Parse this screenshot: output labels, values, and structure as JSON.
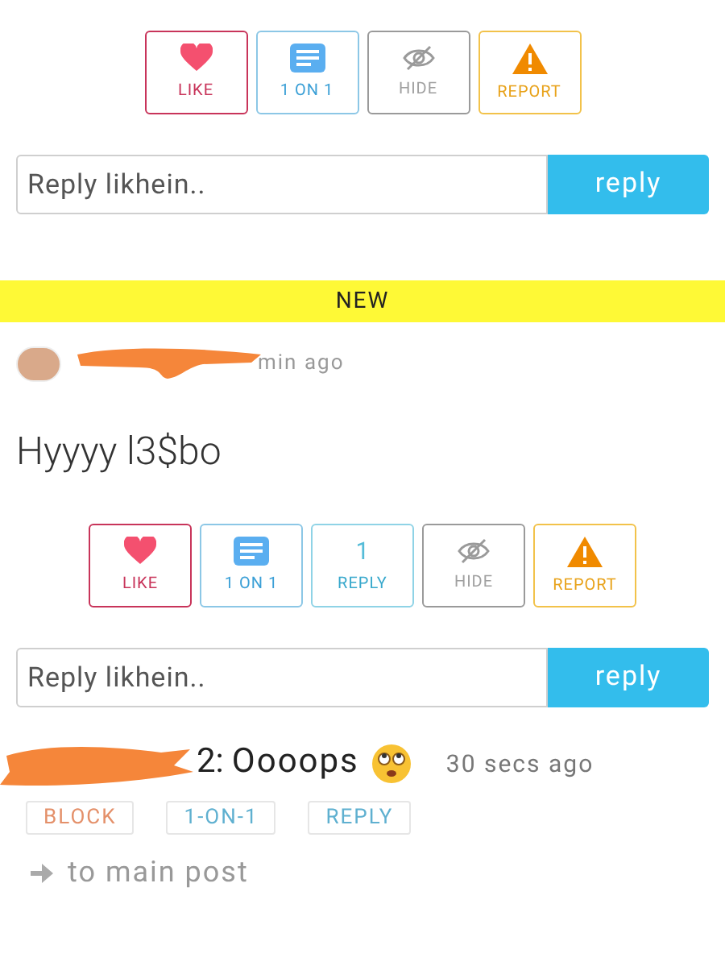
{
  "top_actions": [
    {
      "kind": "like",
      "label": "LIKE"
    },
    {
      "kind": "chat",
      "label": "1 ON 1"
    },
    {
      "kind": "hide",
      "label": "HIDE"
    },
    {
      "kind": "report",
      "label": "REPORT"
    }
  ],
  "top_reply": {
    "placeholder": "Reply likhein..",
    "button": "reply"
  },
  "new_banner": "NEW",
  "post": {
    "time": "min ago",
    "text": "Hyyyy l3$bo",
    "actions": [
      {
        "kind": "like",
        "label": "LIKE"
      },
      {
        "kind": "chat",
        "label": "1 ON 1"
      },
      {
        "kind": "reply",
        "count": "1",
        "label": "REPLY"
      },
      {
        "kind": "hide",
        "label": "HIDE"
      },
      {
        "kind": "report",
        "label": "REPORT"
      }
    ],
    "reply_box": {
      "placeholder": "Reply likhein..",
      "button": "reply"
    },
    "comment": {
      "author_tail": "2:",
      "text": "Oooops",
      "time": "30 secs ago",
      "buttons": [
        {
          "kind": "block",
          "label": "BLOCK"
        },
        {
          "kind": "chat",
          "label": "1-ON-1"
        },
        {
          "kind": "reply",
          "label": "REPLY"
        }
      ],
      "link": "to main post"
    }
  }
}
